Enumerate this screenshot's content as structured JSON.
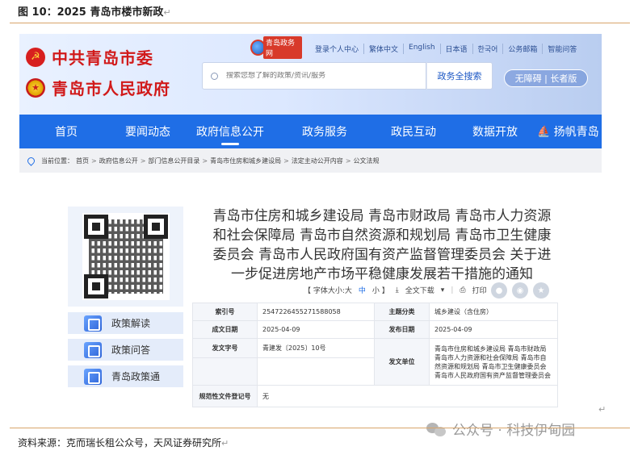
{
  "figure": {
    "title": "图 10：2025 青岛市楼市新政",
    "source": "资料来源：克而瑞长租公众号，天风证券研究所",
    "watermark": "公众号 · 科技伊甸园",
    "return_mark": "↵",
    "accent_color": "#d8a46a"
  },
  "header": {
    "party_name": "中共青岛市委",
    "gov_name": "青岛市人民政府",
    "portal_logo": "青岛政务网",
    "top_links": [
      "登录个人中心",
      "繁体中文",
      "English",
      "日本语",
      "한국어",
      "公务邮箱",
      "智能问答"
    ],
    "search_placeholder": "搜索您想了解的政策/资讯/服务",
    "search_button": "政务全搜索",
    "accessibility": "无障碍 | 长者版"
  },
  "nav": {
    "items": [
      "首页",
      "要闻动态",
      "政府信息公开",
      "政务服务",
      "政民互动",
      "数据开放",
      "扬帆青岛"
    ],
    "active_index": 2,
    "color": "#1f6ee6"
  },
  "breadcrumb": {
    "label": "当前位置：",
    "items": [
      "首页",
      "政府信息公开",
      "部门信息公开目录",
      "青岛市住房和城乡建设局",
      "法定主动公开内容",
      "公文法规"
    ],
    "separator": ">"
  },
  "sidebar": {
    "items": [
      {
        "label": "政策解读",
        "icon": "policy-reading-icon"
      },
      {
        "label": "政策问答",
        "icon": "policy-qa-icon"
      },
      {
        "label": "青岛政策通",
        "icon": "policy-portal-icon"
      }
    ]
  },
  "document": {
    "title_lines": [
      "青岛市住房和城乡建设局 青岛市财政局 青岛市人力资源",
      "和社会保障局 青岛市自然资源和规划局 青岛市卫生健康",
      "委员会 青岛市人民政府国有资产监督管理委员会 关于进",
      "一步促进房地产市场平稳健康发展若干措施的通知"
    ],
    "tools": {
      "font_label": "【 字体大小:大",
      "font_mid": "中",
      "font_small": "小 】",
      "fulltext": "全文下载",
      "print": "打印"
    },
    "meta": {
      "index_label": "索引号",
      "index_value": "2547226455271588058",
      "category_label": "主题分类",
      "category_value": "城乡建设（含住房）",
      "created_label": "成文日期",
      "created_value": "2025-04-09",
      "published_label": "发布日期",
      "published_value": "2025-04-09",
      "docno_label": "发文字号",
      "docno_value": "青建发〔2025〕10号",
      "issuer_label": "发文单位",
      "issuer_value": "青岛市住房和城乡建设局 青岛市财政局 青岛市人力资源和社会保障局 青岛市自然资源和规划局 青岛市卫生健康委员会 青岛市人民政府国有资产监督管理委员会",
      "regno_label": "规范性文件登记号",
      "regno_value": "无"
    }
  }
}
